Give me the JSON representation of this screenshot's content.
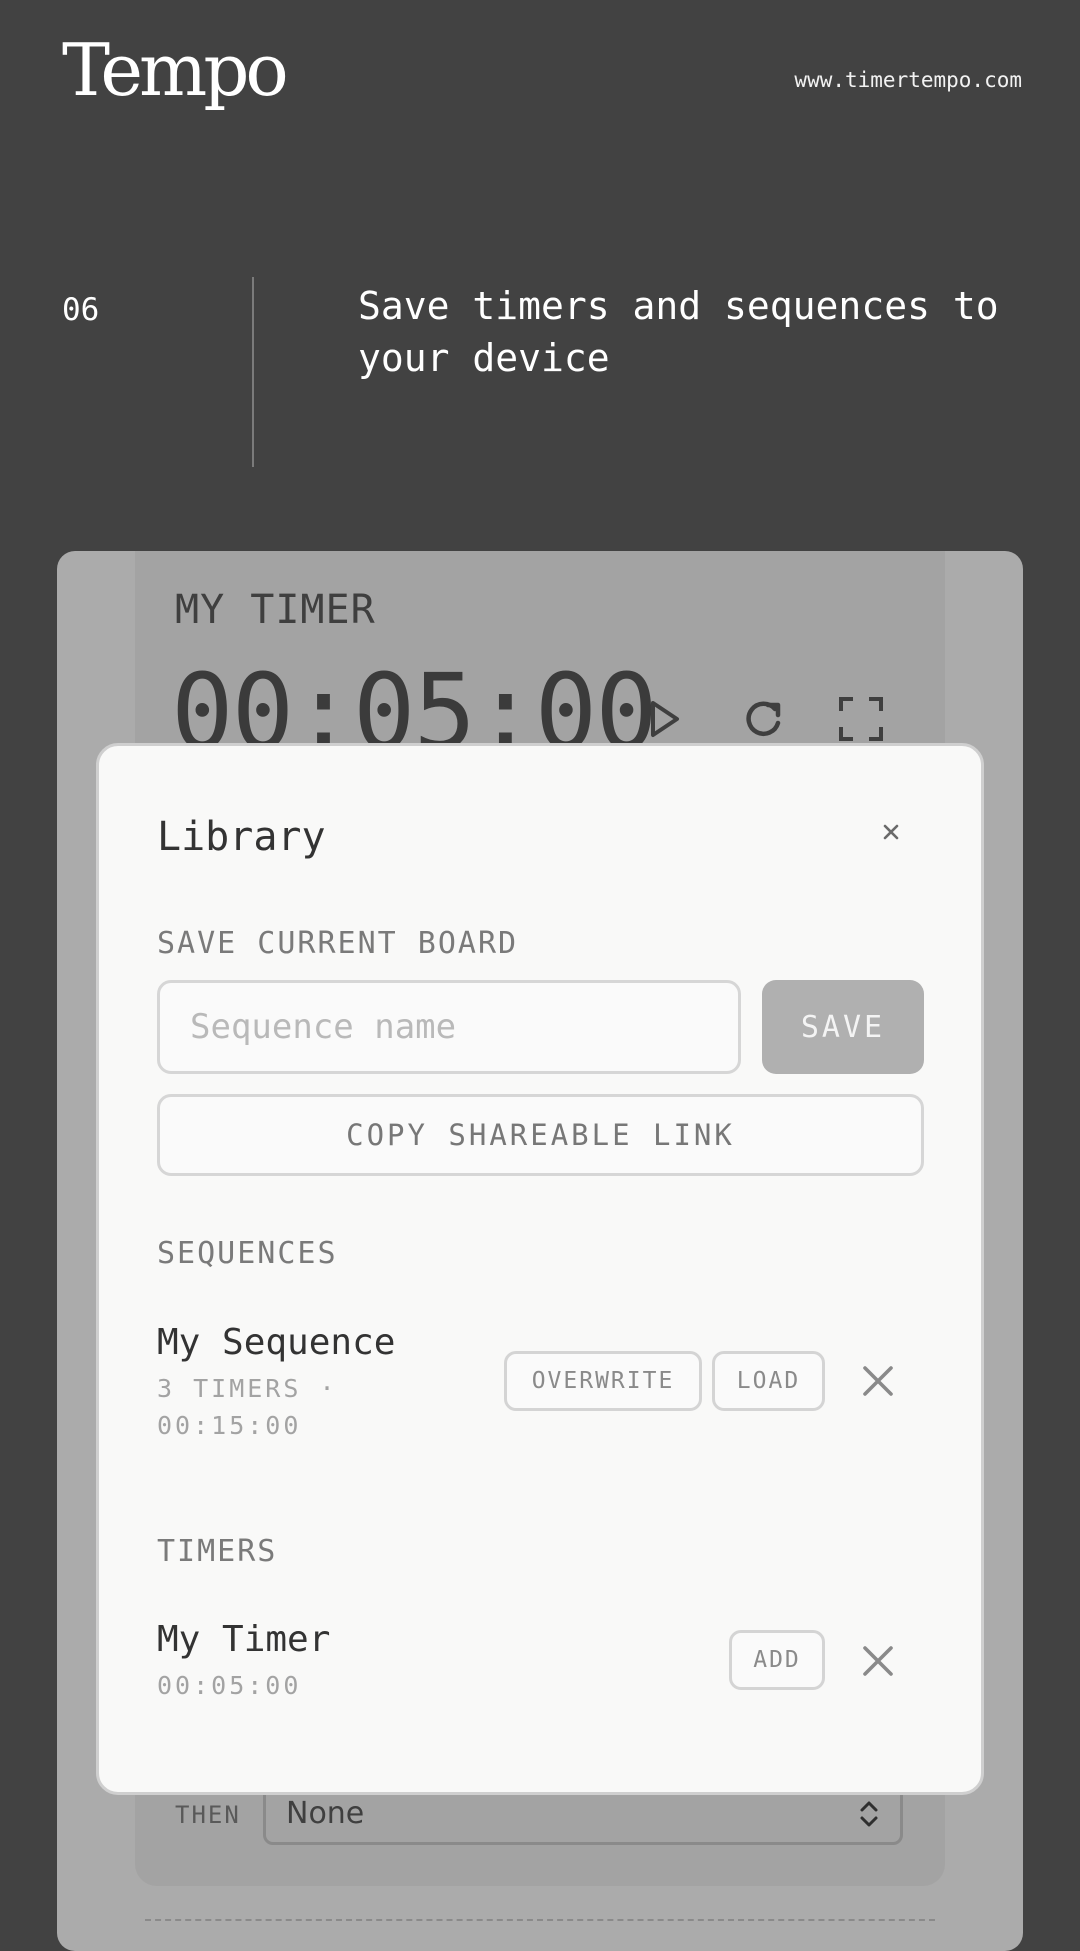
{
  "brand": {
    "logo": "Tempo",
    "url": "www.timertempo.com"
  },
  "step": {
    "number": "06",
    "headline": "Save timers and sequences to your device"
  },
  "app": {
    "timer_title": "MY TIMER",
    "timer_time": "00:05:00",
    "then_label": "THEN",
    "then_value": "None",
    "icons": [
      "play-icon",
      "reset-icon",
      "fullscreen-icon",
      "select-chevron-icon"
    ]
  },
  "modal": {
    "title": "Library",
    "close_label": "×",
    "save_section_label": "SAVE CURRENT BOARD",
    "name_placeholder": "Sequence name",
    "save_label": "SAVE",
    "copy_label": "COPY SHAREABLE LINK",
    "sequences_label": "SEQUENCES",
    "sequences": [
      {
        "name": "My Sequence",
        "meta": "3 TIMERS · 00:15:00",
        "overwrite_label": "OVERWRITE",
        "load_label": "LOAD"
      }
    ],
    "timers_label": "TIMERS",
    "timers": [
      {
        "name": "My Timer",
        "meta": "00:05:00",
        "add_label": "ADD"
      }
    ]
  },
  "colors": {
    "page_bg": "#424242",
    "card_bg": "#ababab",
    "modal_bg": "#f9f9f8",
    "muted_text": "#7a7a7a"
  }
}
